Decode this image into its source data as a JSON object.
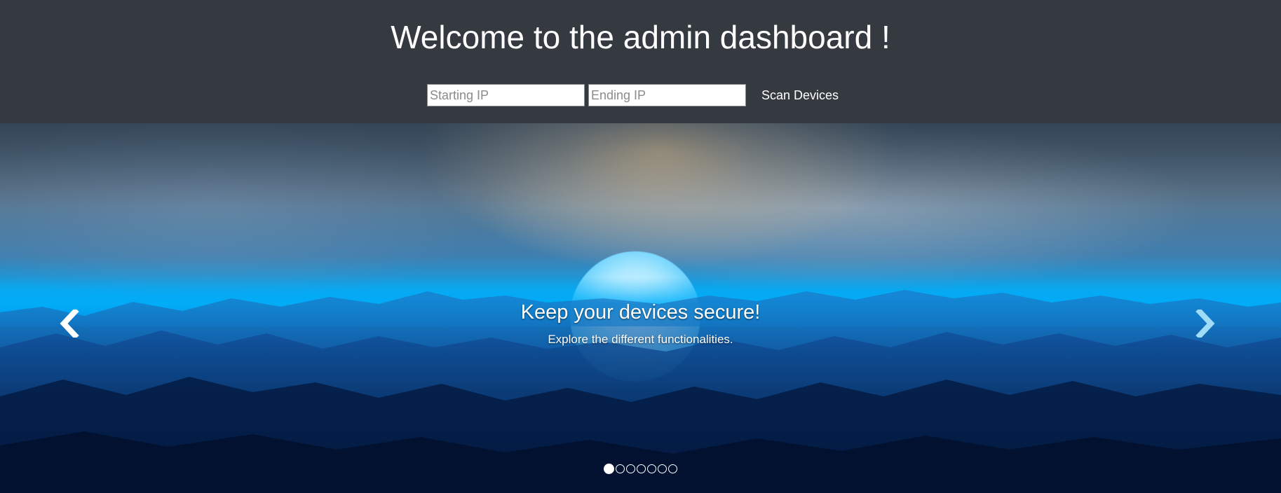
{
  "header": {
    "title": "Welcome to the admin dashboard !",
    "background_color": "#343a40"
  },
  "scan_form": {
    "starting_ip": {
      "value": "",
      "placeholder": "Starting IP"
    },
    "ending_ip": {
      "value": "",
      "placeholder": "Ending IP"
    },
    "scan_button_label": "Scan Devices"
  },
  "carousel": {
    "slide": {
      "title": "Keep your devices secure!",
      "subtitle": "Explore the different functionalities."
    },
    "prev_icon": "chevron-left-icon",
    "next_icon": "chevron-right-icon",
    "indicator_count": 7,
    "active_index": 0
  }
}
